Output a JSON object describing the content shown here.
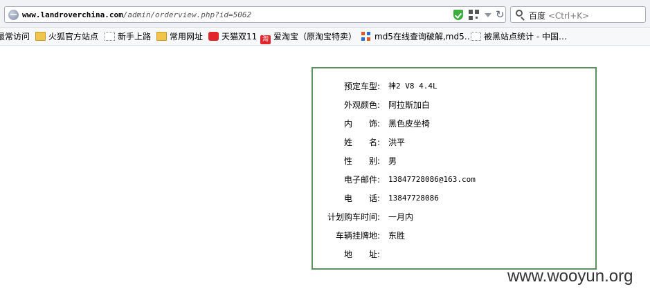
{
  "browser": {
    "url_host": "www.landroverchina.com",
    "url_path": "/admin/orderview.php?id=5062",
    "search": {
      "engine": "百度",
      "shortcut": "<Ctrl+K>"
    }
  },
  "bookmarks": [
    {
      "label": "最常访问",
      "icon": "none"
    },
    {
      "label": "火狐官方站点",
      "icon": "folder-icon"
    },
    {
      "label": "新手上路",
      "icon": "blank-page-icon"
    },
    {
      "label": "常用网址",
      "icon": "folder-icon"
    },
    {
      "label": "天猫双11",
      "icon": "tmall-icon"
    },
    {
      "label": "爱淘宝（原淘宝特卖）",
      "icon": "taobao-icon",
      "icon_text": "淘"
    },
    {
      "label": "md5在线查询破解,md5…",
      "icon": "md5-icon"
    },
    {
      "label": "被黑站点统计 - 中国…",
      "icon": "blank-page-icon"
    }
  ],
  "order": {
    "fields": [
      {
        "label": "预定车型:",
        "value": "神2 V8 4.4L"
      },
      {
        "label": "外观颜色:",
        "value": "阿拉斯加白"
      },
      {
        "label": "内　　饰:",
        "value": "黑色皮坐椅"
      },
      {
        "label": "姓　　名:",
        "value": "洪平"
      },
      {
        "label": "性　　别:",
        "value": "男"
      },
      {
        "label": "电子邮件:",
        "value": "13847728086@163.com"
      },
      {
        "label": "电　　话:",
        "value": "13847728086"
      },
      {
        "label": "计划购车时间:",
        "value": "一月内"
      },
      {
        "label": "车辆挂牌地:",
        "value": "东胜"
      },
      {
        "label": "地　　址:",
        "value": ""
      }
    ],
    "border_color": "#5b8f5e"
  },
  "watermark": "www.wooyun.org"
}
